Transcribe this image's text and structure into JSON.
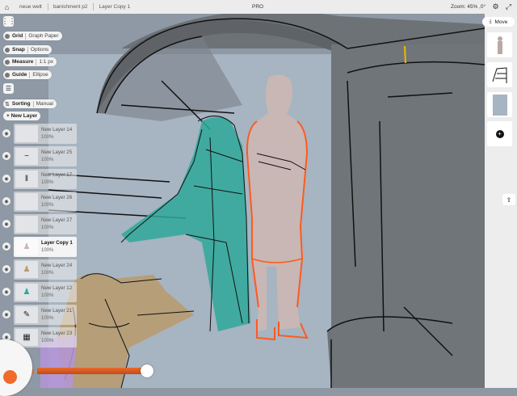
{
  "topbar": {
    "breadcrumbs": [
      "neue welt",
      "banishment p2",
      "Layer Copy 1"
    ],
    "center_label": "PRO",
    "zoom": "Zoom: 45% ,0°",
    "icons": [
      "gear-icon",
      "fullscreen-icon"
    ]
  },
  "tools": {
    "grid": {
      "label": "Grid",
      "value": "Graph Paper"
    },
    "snap": {
      "label": "Snap",
      "value": "Options"
    },
    "measure": {
      "label": "Measure",
      "value": "1:1 px"
    },
    "guide": {
      "label": "Guide",
      "value": "Ellipse"
    }
  },
  "sorting": {
    "label": "Sorting",
    "value": "Manual"
  },
  "new_layer_label": "+ New Layer",
  "layers": [
    {
      "name": "New Layer 14",
      "opacity": "100%",
      "active": false
    },
    {
      "name": "New Layer 25",
      "opacity": "100%",
      "active": false
    },
    {
      "name": "New Layer 17",
      "opacity": "100%",
      "active": false
    },
    {
      "name": "New Layer 26",
      "opacity": "100%",
      "active": false
    },
    {
      "name": "New Layer 27",
      "opacity": "100%",
      "active": false
    },
    {
      "name": "Layer Copy 1",
      "opacity": "100%",
      "active": true
    },
    {
      "name": "New Layer 24",
      "opacity": "100%",
      "active": false
    },
    {
      "name": "New Layer 12",
      "opacity": "100%",
      "active": false
    },
    {
      "name": "New Layer 21",
      "opacity": "100%",
      "active": false
    },
    {
      "name": "New Layer 23",
      "opacity": "100%",
      "active": false
    }
  ],
  "right_panel": {
    "move_label": "Move"
  },
  "colors": {
    "brush": "#f06a2a",
    "accent_outline": "#ff5a1f",
    "teal": "#2ea89a"
  }
}
